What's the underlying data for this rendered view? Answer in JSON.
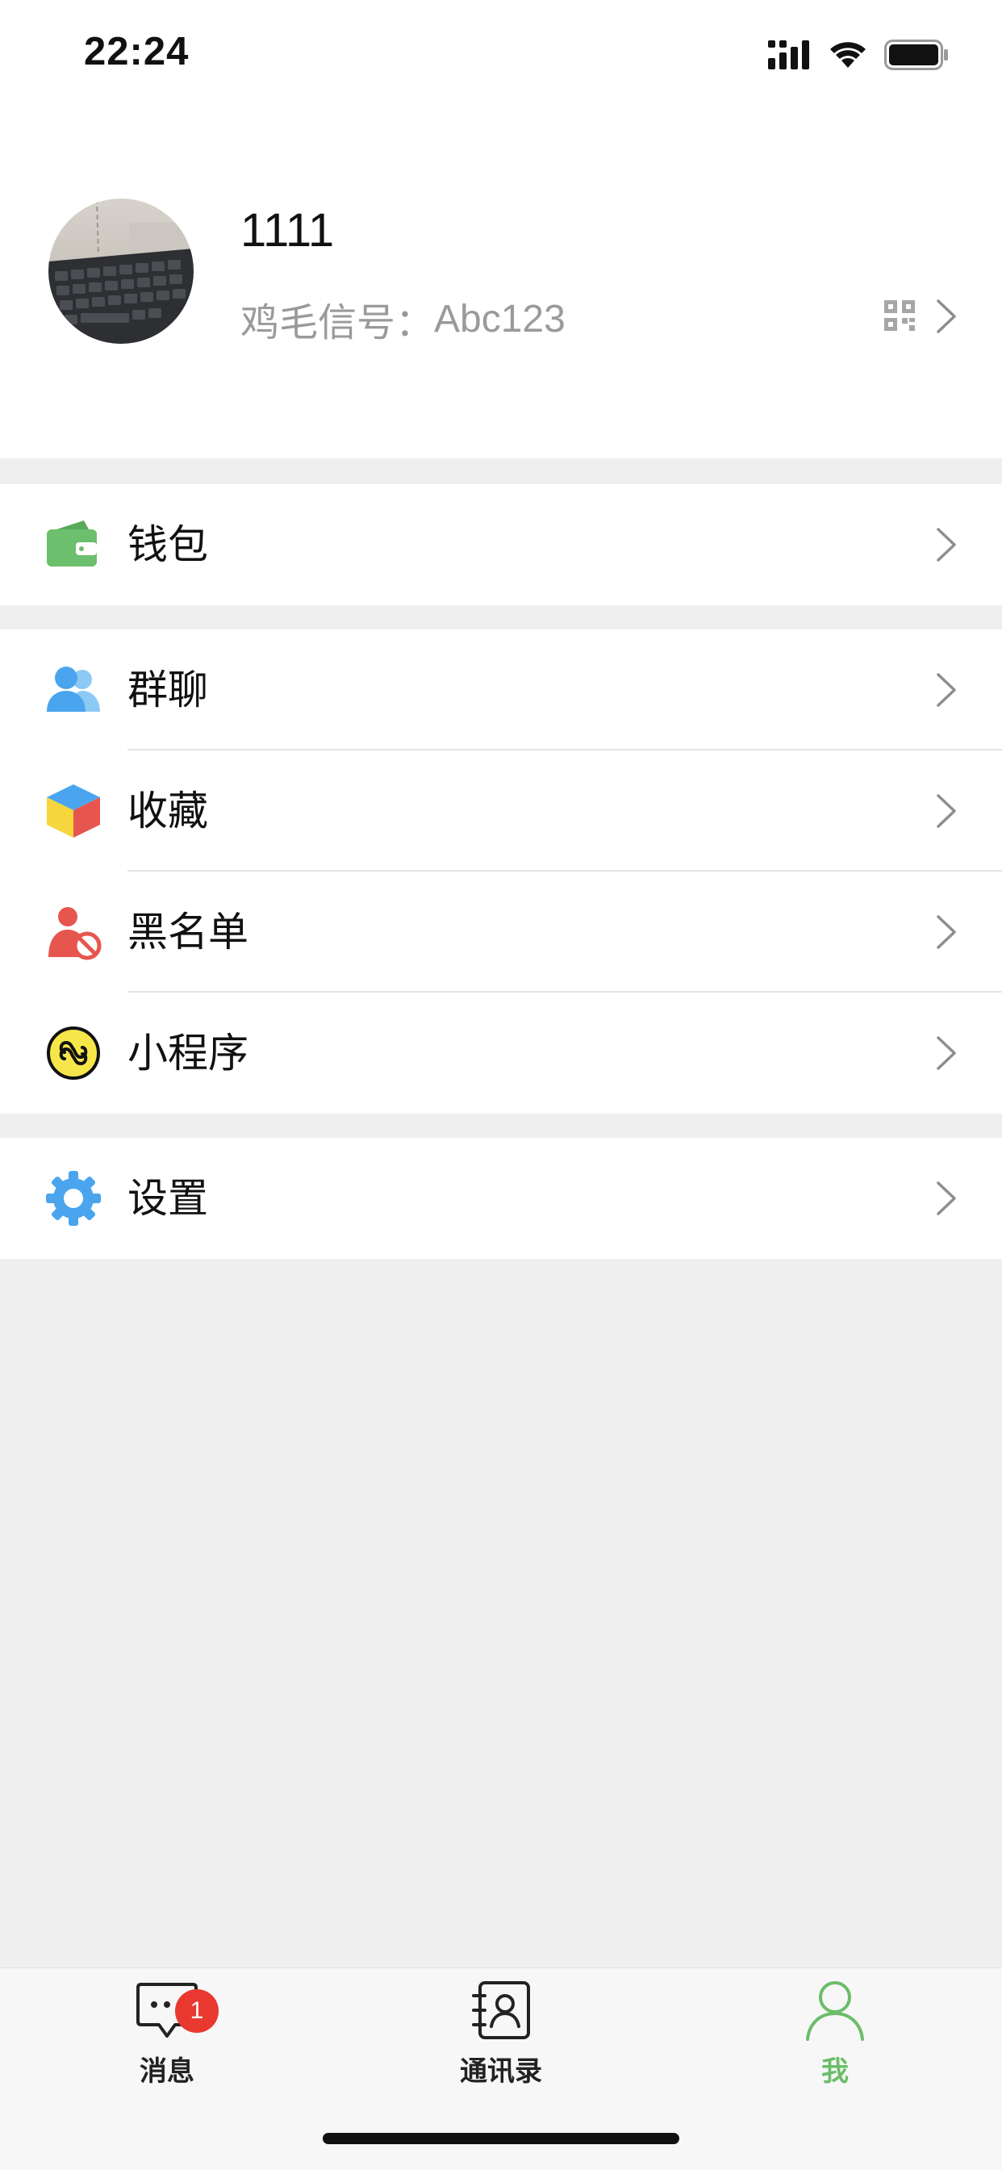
{
  "status_bar": {
    "time": "22:24"
  },
  "profile": {
    "name": "1111",
    "id_label": "鸡毛信号：",
    "id_value": "Abc123"
  },
  "menu_groups": [
    {
      "items": [
        {
          "label": "钱包",
          "icon": "wallet-icon"
        }
      ]
    },
    {
      "items": [
        {
          "label": "群聊",
          "icon": "group-chat-icon"
        },
        {
          "label": "收藏",
          "icon": "favorites-cube-icon"
        },
        {
          "label": "黑名单",
          "icon": "blacklist-icon"
        },
        {
          "label": "小程序",
          "icon": "mini-program-icon"
        }
      ]
    },
    {
      "items": [
        {
          "label": "设置",
          "icon": "gear-icon"
        }
      ]
    }
  ],
  "tabbar": {
    "tabs": [
      {
        "label": "消息",
        "icon": "message-bubble-icon",
        "badge": "1",
        "active": false
      },
      {
        "label": "通讯录",
        "icon": "contacts-icon",
        "active": false
      },
      {
        "label": "我",
        "icon": "person-icon",
        "active": true
      }
    ]
  },
  "colors": {
    "accent_green": "#6cbd6a",
    "badge_red": "#e8382f",
    "background": "#efefef",
    "secondary_text": "#9a9a9a"
  }
}
